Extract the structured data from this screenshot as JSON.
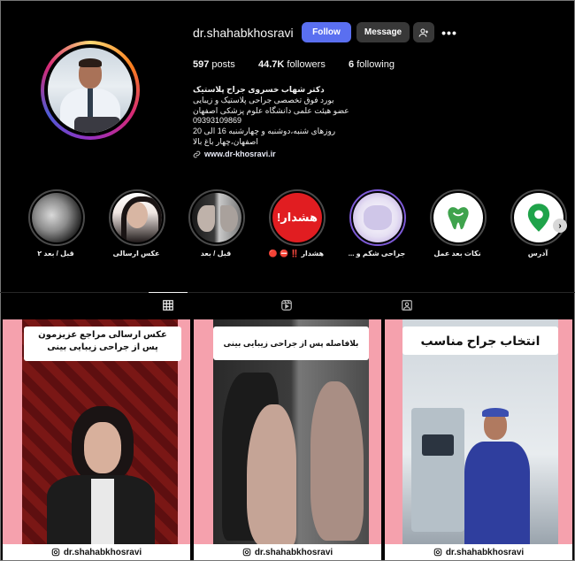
{
  "profile": {
    "username": "dr.shahabkhosravi",
    "follow_label": "Follow",
    "message_label": "Message",
    "more_label": "•••",
    "posts_count": "597",
    "posts_label": "posts",
    "followers_count": "44.7K",
    "followers_label": "followers",
    "following_count": "6",
    "following_label": "following",
    "bio_name": "دکتر شهاب خسروی جراح پلاستیک",
    "bio_lines": [
      "بورد فوق تخصصی جراحی پلاستیک و زیبایی",
      "عضو هیئت علمی دانشگاه علوم پزشکی اصفهان",
      "09393109869",
      "روزهای شنبه،دوشنبه و چهارشنبه 16 الی 20",
      "اصفهان،چهار باغ بالا"
    ],
    "website": "www.dr-khosravi.ir"
  },
  "highlights": [
    {
      "label": "قبل / بعد ۲",
      "icon": "photo-highlight-icon"
    },
    {
      "label": "عکس ارسالی",
      "icon": "photo-highlight-icon"
    },
    {
      "label": "قبل / بعد",
      "icon": "photo-highlight-icon"
    },
    {
      "label": "هشدار ‼️ ⛔️ 🔴",
      "icon": "warning-highlight-icon",
      "inner_text": "هشدار!"
    },
    {
      "label": "جراحی شکم و ...",
      "icon": "photo-highlight-icon"
    },
    {
      "label": "نکات بعد عمل",
      "icon": "tooth-icon"
    },
    {
      "label": "آدرس",
      "icon": "location-pin-icon"
    }
  ],
  "tabs": [
    {
      "name": "posts-grid-tab",
      "active": true
    },
    {
      "name": "reels-tab",
      "active": false
    },
    {
      "name": "tagged-tab",
      "active": false
    }
  ],
  "posts": [
    {
      "title_line1": "عکس ارسالی مراجع عزیزمون",
      "title_line2": "پس از جراحی زیبایی بینی",
      "handle": "dr.shahabkhosravi"
    },
    {
      "title_line1": "بلافاصله پس از جراحی زیبایی بینی",
      "handle": "dr.shahabkhosravi"
    },
    {
      "title_line1": "انتخاب جراح مناسب",
      "handle": "dr.shahabkhosravi"
    }
  ],
  "colors": {
    "follow_button": "#5a6ff0",
    "secondary_button": "#383838",
    "post_frame_pink": "#f5a1ad",
    "warning_red": "#e11d21",
    "location_green": "#1fa34a"
  }
}
